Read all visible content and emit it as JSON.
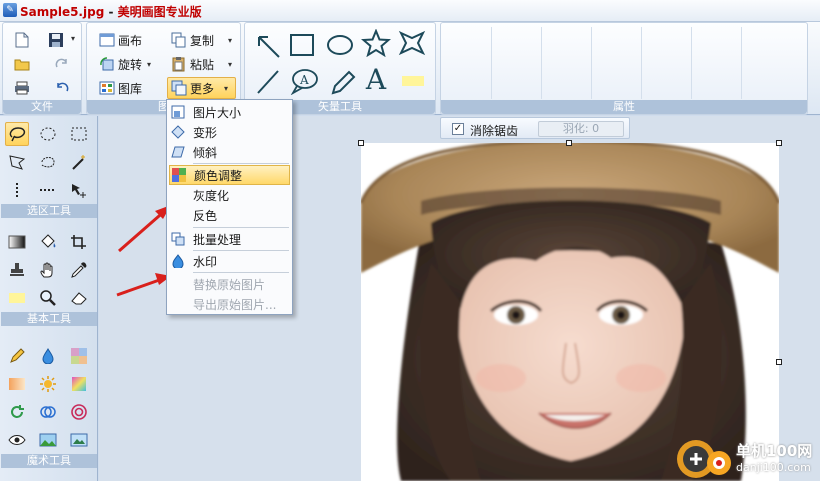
{
  "title": {
    "filename": "Sample5.jpg",
    "separator": " - ",
    "app_name": "美明画图专业版"
  },
  "ribbon": {
    "file_group_label": "文件",
    "image_group_label": "图",
    "vector_group_label": "矢量工具",
    "props_group_label": "属性",
    "canvas_label": "画布",
    "rotate_label": "旋转",
    "gallery_label": "图库",
    "copy_label": "复制",
    "paste_label": "粘贴",
    "more_label": "更多"
  },
  "toolbox": {
    "selection_label": "选区工具",
    "basic_label": "基本工具",
    "magic_label": "魔术工具"
  },
  "options": {
    "antialias_label": "消除锯齿",
    "antialias_checked": "✓",
    "feather_label": "羽化: 0"
  },
  "menu": {
    "items": [
      {
        "label": "图片大小"
      },
      {
        "label": "变形"
      },
      {
        "label": "倾斜"
      },
      {
        "label": "颜色调整"
      },
      {
        "label": "灰度化"
      },
      {
        "label": "反色"
      },
      {
        "label": "批量处理"
      },
      {
        "label": "水印"
      },
      {
        "label": "替换原始图片"
      },
      {
        "label": "导出原始图片..."
      }
    ]
  },
  "vector_text_glyph": "A",
  "watermark": {
    "name": "单机100网",
    "url": "danji100.com"
  },
  "colors": {
    "accent_red": "#d9201c",
    "hot_yellow": "#ffd35c",
    "panel_blue": "#aec2da"
  }
}
